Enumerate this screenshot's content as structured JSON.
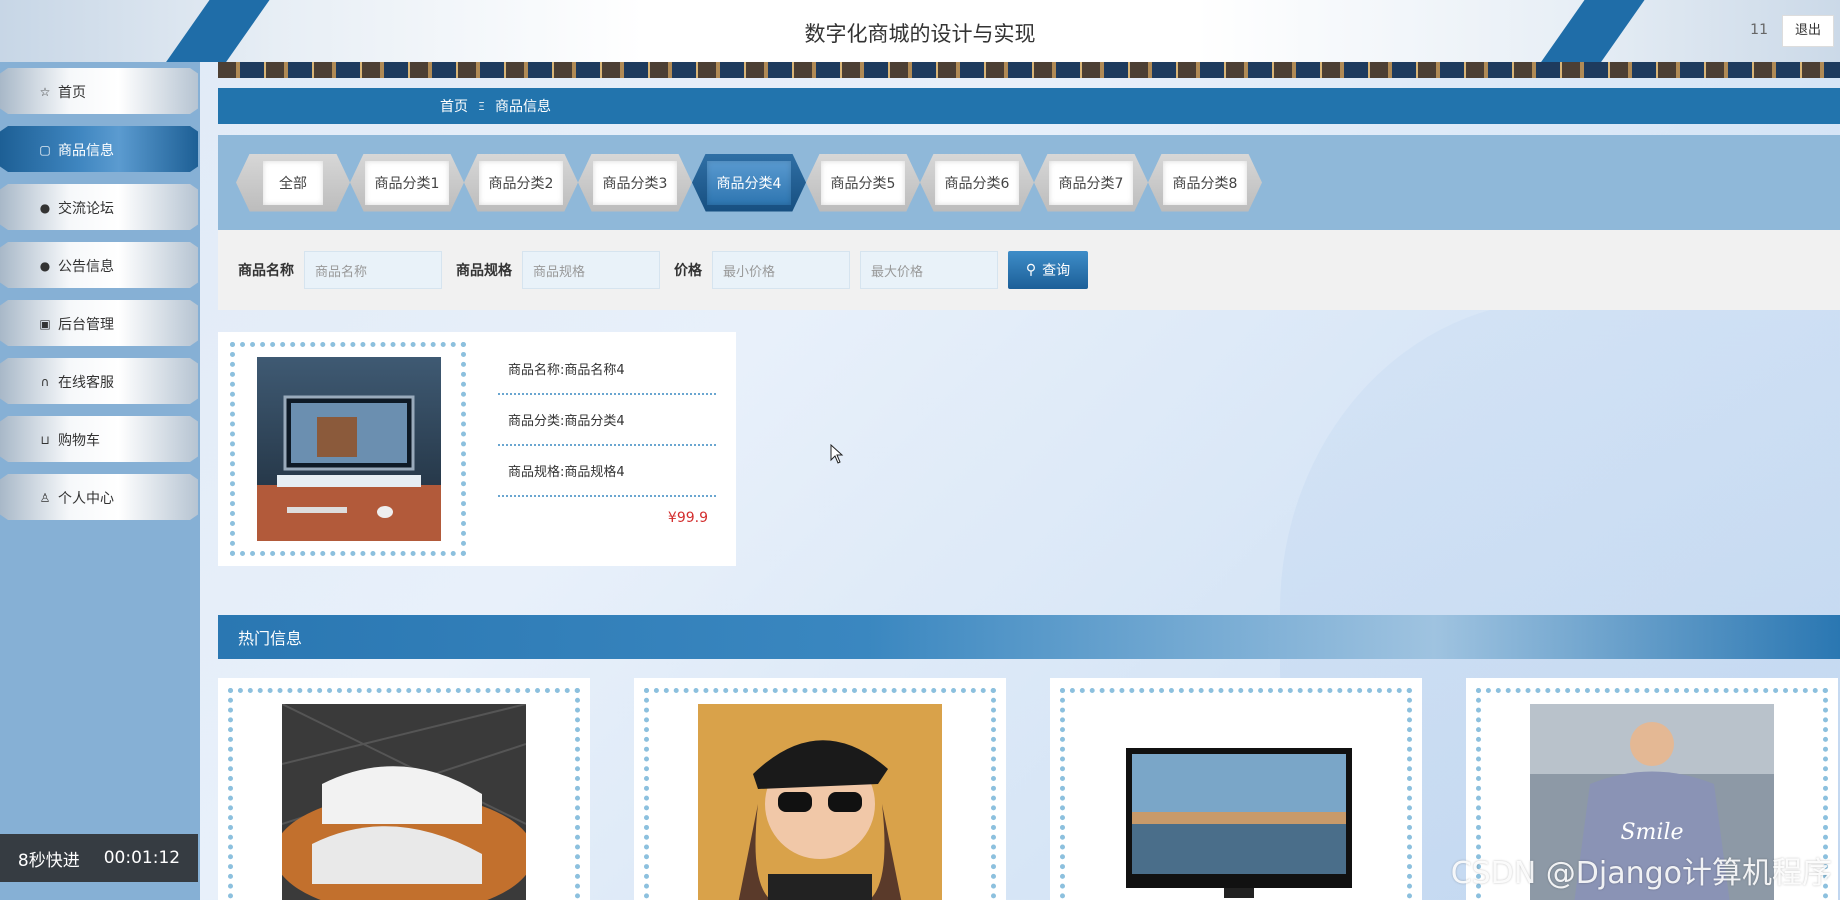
{
  "header": {
    "title": "数字化商城的设计与实现",
    "user": "11",
    "logout": "退出"
  },
  "sidebar": {
    "items": [
      {
        "label": "首页",
        "icon": "star-icon"
      },
      {
        "label": "商品信息",
        "icon": "bag-icon",
        "active": true
      },
      {
        "label": "交流论坛",
        "icon": "alert-icon"
      },
      {
        "label": "公告信息",
        "icon": "help-icon"
      },
      {
        "label": "后台管理",
        "icon": "box-icon"
      },
      {
        "label": "在线客服",
        "icon": "headset-icon"
      },
      {
        "label": "购物车",
        "icon": "cart-icon"
      },
      {
        "label": "个人中心",
        "icon": "person-icon"
      }
    ]
  },
  "overlay": {
    "speed": "8秒快进",
    "time": "00:01:12"
  },
  "breadcrumb": {
    "home": "首页",
    "separator": "Ξ",
    "current": "商品信息"
  },
  "categories": [
    "全部",
    "商品分类1",
    "商品分类2",
    "商品分类3",
    "商品分类4",
    "商品分类5",
    "商品分类6",
    "商品分类7",
    "商品分类8"
  ],
  "active_category": "商品分类4",
  "search": {
    "name_label": "商品名称",
    "name_placeholder": "商品名称",
    "spec_label": "商品规格",
    "spec_placeholder": "商品规格",
    "price_label": "价格",
    "min_placeholder": "最小价格",
    "max_placeholder": "最大价格",
    "button": "查询"
  },
  "product": {
    "name": "商品名称:商品名称4",
    "category": "商品分类:商品分类4",
    "spec": "商品规格:商品规格4",
    "price": "¥99.9"
  },
  "hot": {
    "title": "热门信息"
  },
  "watermark": "CSDN @Django计算机程序",
  "colors": {
    "primary": "#2274ad",
    "sidebar": "#86b0d5",
    "price": "#d32f2f"
  }
}
